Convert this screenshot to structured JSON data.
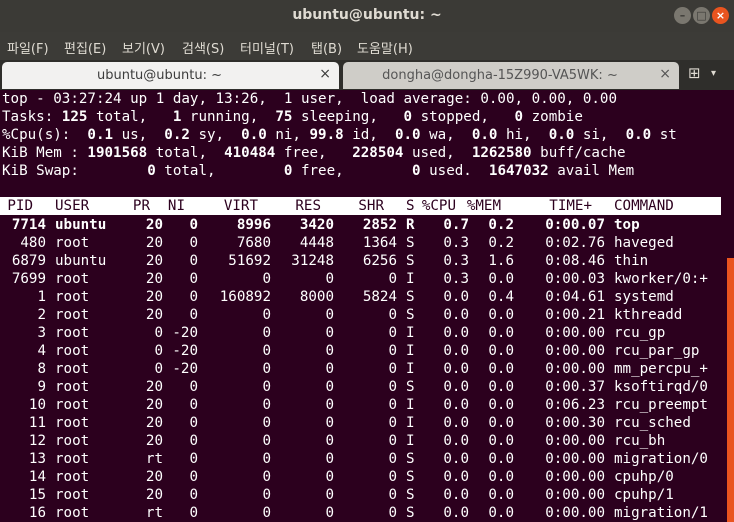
{
  "window": {
    "title": "ubuntu@ubuntu: ~"
  },
  "menu": [
    "파일(F)",
    "편집(E)",
    "보기(V)",
    "검색(S)",
    "터미널(T)",
    "탭(B)",
    "도움말(H)"
  ],
  "tabs": [
    {
      "label": "ubuntu@ubuntu: ~",
      "close": "×"
    },
    {
      "label": "dongha@dongha-15Z990-VA5WK: ~",
      "close": "×"
    }
  ],
  "icons": {
    "new_tab": "new-tab-icon",
    "tab_menu": "chevron-down-icon",
    "minimize": "minimize-icon",
    "maximize": "maximize-icon",
    "close": "close-icon"
  },
  "glyphs": {
    "minimize": "–",
    "maximize": "□",
    "close": "×",
    "new_tab": "⊞",
    "tab_menu": "▾"
  },
  "colors": {
    "terminal_bg": "#2c001e",
    "accent": "#e9541f"
  },
  "summary": {
    "l1": "top - 03:27:24 up 1 day, 13:26,  1 user,  load average: 0.00, 0.00, 0.00",
    "l2": [
      {
        "t": "Tasks: ",
        "b": false
      },
      {
        "t": "125",
        "b": true
      },
      {
        "t": " total,   ",
        "b": false
      },
      {
        "t": "1",
        "b": true
      },
      {
        "t": " running,  ",
        "b": false
      },
      {
        "t": "75",
        "b": true
      },
      {
        "t": " sleeping,   ",
        "b": false
      },
      {
        "t": "0",
        "b": true
      },
      {
        "t": " stopped,   ",
        "b": false
      },
      {
        "t": "0",
        "b": true
      },
      {
        "t": " zombie",
        "b": false
      }
    ],
    "l3": [
      {
        "t": "%Cpu(s):  ",
        "b": false
      },
      {
        "t": "0.1",
        "b": true
      },
      {
        "t": " us,  ",
        "b": false
      },
      {
        "t": "0.2",
        "b": true
      },
      {
        "t": " sy,  ",
        "b": false
      },
      {
        "t": "0.0",
        "b": true
      },
      {
        "t": " ni, ",
        "b": false
      },
      {
        "t": "99.8",
        "b": true
      },
      {
        "t": " id,  ",
        "b": false
      },
      {
        "t": "0.0",
        "b": true
      },
      {
        "t": " wa,  ",
        "b": false
      },
      {
        "t": "0.0",
        "b": true
      },
      {
        "t": " hi,  ",
        "b": false
      },
      {
        "t": "0.0",
        "b": true
      },
      {
        "t": " si,  ",
        "b": false
      },
      {
        "t": "0.0",
        "b": true
      },
      {
        "t": " st",
        "b": false
      }
    ],
    "l4": [
      {
        "t": "KiB Mem : ",
        "b": false
      },
      {
        "t": "1901568",
        "b": true
      },
      {
        "t": " total,  ",
        "b": false
      },
      {
        "t": "410484",
        "b": true
      },
      {
        "t": " free,   ",
        "b": false
      },
      {
        "t": "228504",
        "b": true
      },
      {
        "t": " used,  ",
        "b": false
      },
      {
        "t": "1262580",
        "b": true
      },
      {
        "t": " buff/cache",
        "b": false
      }
    ],
    "l5": [
      {
        "t": "KiB Swap:        ",
        "b": false
      },
      {
        "t": "0",
        "b": true
      },
      {
        "t": " total,        ",
        "b": false
      },
      {
        "t": "0",
        "b": true
      },
      {
        "t": " free,        ",
        "b": false
      },
      {
        "t": "0",
        "b": true
      },
      {
        "t": " used.  ",
        "b": false
      },
      {
        "t": "1647032",
        "b": true
      },
      {
        "t": " avail Mem",
        "b": false
      }
    ]
  },
  "columns": [
    "PID",
    "USER",
    "PR",
    "NI",
    "VIRT",
    "RES",
    "SHR",
    "S",
    "%CPU",
    "%MEM",
    "TIME+",
    "COMMAND"
  ],
  "processes": [
    {
      "pid": "7714",
      "user": "ubuntu",
      "pr": "20",
      "ni": "0",
      "virt": "8996",
      "res": "3420",
      "shr": "2852",
      "s": "R",
      "cpu": "0.7",
      "mem": "0.2",
      "time": "0:00.07",
      "cmd": "top",
      "bold": true
    },
    {
      "pid": "480",
      "user": "root",
      "pr": "20",
      "ni": "0",
      "virt": "7680",
      "res": "4448",
      "shr": "1364",
      "s": "S",
      "cpu": "0.3",
      "mem": "0.2",
      "time": "0:02.76",
      "cmd": "haveged"
    },
    {
      "pid": "6879",
      "user": "ubuntu",
      "pr": "20",
      "ni": "0",
      "virt": "51692",
      "res": "31248",
      "shr": "6256",
      "s": "S",
      "cpu": "0.3",
      "mem": "1.6",
      "time": "0:08.46",
      "cmd": "thin"
    },
    {
      "pid": "7699",
      "user": "root",
      "pr": "20",
      "ni": "0",
      "virt": "0",
      "res": "0",
      "shr": "0",
      "s": "I",
      "cpu": "0.3",
      "mem": "0.0",
      "time": "0:00.03",
      "cmd": "kworker/0:+"
    },
    {
      "pid": "1",
      "user": "root",
      "pr": "20",
      "ni": "0",
      "virt": "160892",
      "res": "8000",
      "shr": "5824",
      "s": "S",
      "cpu": "0.0",
      "mem": "0.4",
      "time": "0:04.61",
      "cmd": "systemd"
    },
    {
      "pid": "2",
      "user": "root",
      "pr": "20",
      "ni": "0",
      "virt": "0",
      "res": "0",
      "shr": "0",
      "s": "S",
      "cpu": "0.0",
      "mem": "0.0",
      "time": "0:00.21",
      "cmd": "kthreadd"
    },
    {
      "pid": "3",
      "user": "root",
      "pr": "0",
      "ni": "-20",
      "virt": "0",
      "res": "0",
      "shr": "0",
      "s": "I",
      "cpu": "0.0",
      "mem": "0.0",
      "time": "0:00.00",
      "cmd": "rcu_gp"
    },
    {
      "pid": "4",
      "user": "root",
      "pr": "0",
      "ni": "-20",
      "virt": "0",
      "res": "0",
      "shr": "0",
      "s": "I",
      "cpu": "0.0",
      "mem": "0.0",
      "time": "0:00.00",
      "cmd": "rcu_par_gp"
    },
    {
      "pid": "8",
      "user": "root",
      "pr": "0",
      "ni": "-20",
      "virt": "0",
      "res": "0",
      "shr": "0",
      "s": "I",
      "cpu": "0.0",
      "mem": "0.0",
      "time": "0:00.00",
      "cmd": "mm_percpu_+"
    },
    {
      "pid": "9",
      "user": "root",
      "pr": "20",
      "ni": "0",
      "virt": "0",
      "res": "0",
      "shr": "0",
      "s": "S",
      "cpu": "0.0",
      "mem": "0.0",
      "time": "0:00.37",
      "cmd": "ksoftirqd/0"
    },
    {
      "pid": "10",
      "user": "root",
      "pr": "20",
      "ni": "0",
      "virt": "0",
      "res": "0",
      "shr": "0",
      "s": "I",
      "cpu": "0.0",
      "mem": "0.0",
      "time": "0:06.23",
      "cmd": "rcu_preempt"
    },
    {
      "pid": "11",
      "user": "root",
      "pr": "20",
      "ni": "0",
      "virt": "0",
      "res": "0",
      "shr": "0",
      "s": "I",
      "cpu": "0.0",
      "mem": "0.0",
      "time": "0:00.30",
      "cmd": "rcu_sched"
    },
    {
      "pid": "12",
      "user": "root",
      "pr": "20",
      "ni": "0",
      "virt": "0",
      "res": "0",
      "shr": "0",
      "s": "I",
      "cpu": "0.0",
      "mem": "0.0",
      "time": "0:00.00",
      "cmd": "rcu_bh"
    },
    {
      "pid": "13",
      "user": "root",
      "pr": "rt",
      "ni": "0",
      "virt": "0",
      "res": "0",
      "shr": "0",
      "s": "S",
      "cpu": "0.0",
      "mem": "0.0",
      "time": "0:00.00",
      "cmd": "migration/0"
    },
    {
      "pid": "14",
      "user": "root",
      "pr": "20",
      "ni": "0",
      "virt": "0",
      "res": "0",
      "shr": "0",
      "s": "S",
      "cpu": "0.0",
      "mem": "0.0",
      "time": "0:00.00",
      "cmd": "cpuhp/0"
    },
    {
      "pid": "15",
      "user": "root",
      "pr": "20",
      "ni": "0",
      "virt": "0",
      "res": "0",
      "shr": "0",
      "s": "S",
      "cpu": "0.0",
      "mem": "0.0",
      "time": "0:00.00",
      "cmd": "cpuhp/1"
    },
    {
      "pid": "16",
      "user": "root",
      "pr": "rt",
      "ni": "0",
      "virt": "0",
      "res": "0",
      "shr": "0",
      "s": "S",
      "cpu": "0.0",
      "mem": "0.0",
      "time": "0:00.00",
      "cmd": "migration/1"
    }
  ]
}
